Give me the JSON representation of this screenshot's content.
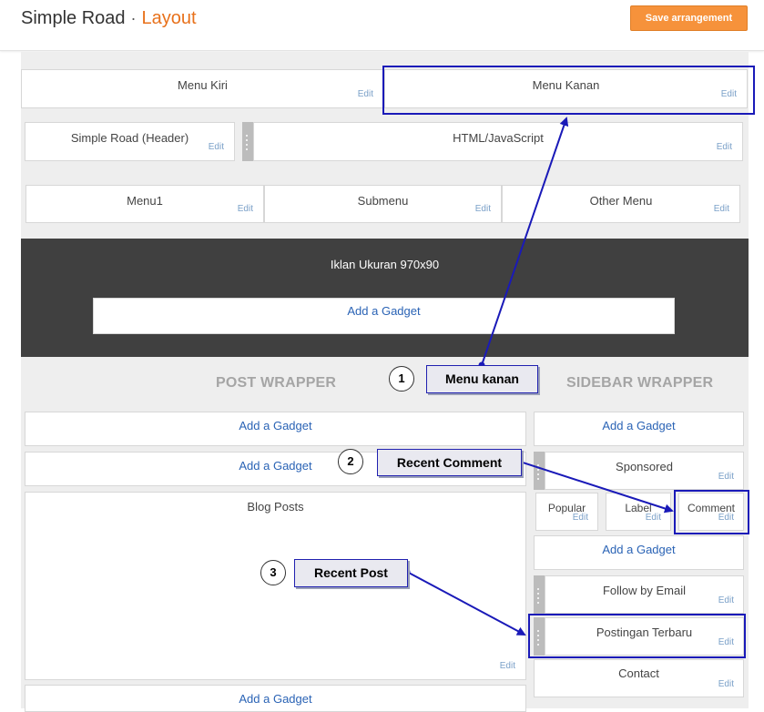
{
  "header": {
    "blog_name": "Simple Road",
    "separator": "·",
    "page_name": "Layout",
    "save_label": "Save arrangement"
  },
  "top_row": {
    "menu_kiri": "Menu Kiri",
    "menu_kanan": "Menu Kanan"
  },
  "row2": {
    "header_gadget": "Simple Road (Header)",
    "html_js": "HTML/JavaScript"
  },
  "menus": [
    "Menu1",
    "Submenu",
    "Other Menu"
  ],
  "ad_band": {
    "title": "Iklan Ukuran 970x90",
    "add": "Add a Gadget"
  },
  "post_wrapper": {
    "title": "POST WRAPPER",
    "add_1": "Add a Gadget",
    "add_2": "Add a Gadget",
    "blog_posts": "Blog Posts",
    "add_3": "Add a Gadget"
  },
  "sidebar_wrapper": {
    "title": "SIDEBAR WRAPPER",
    "add_1": "Add a Gadget",
    "sponsored": "Sponsored",
    "tabs": [
      "Popular",
      "Label",
      "Comment"
    ],
    "add_2": "Add a Gadget",
    "follow": "Follow by Email",
    "postingan": "Postingan Terbaru",
    "contact": "Contact"
  },
  "edit_label": "Edit",
  "annotations": [
    {
      "num": "1",
      "label": "Menu kanan"
    },
    {
      "num": "2",
      "label": "Recent Comment"
    },
    {
      "num": "3",
      "label": "Recent Post"
    }
  ],
  "colors": {
    "accent": "#e8711b",
    "save_button": "#f6923b",
    "link": "#2a63b5",
    "annotation": "#1a1ab8",
    "dark_band": "#404040"
  }
}
